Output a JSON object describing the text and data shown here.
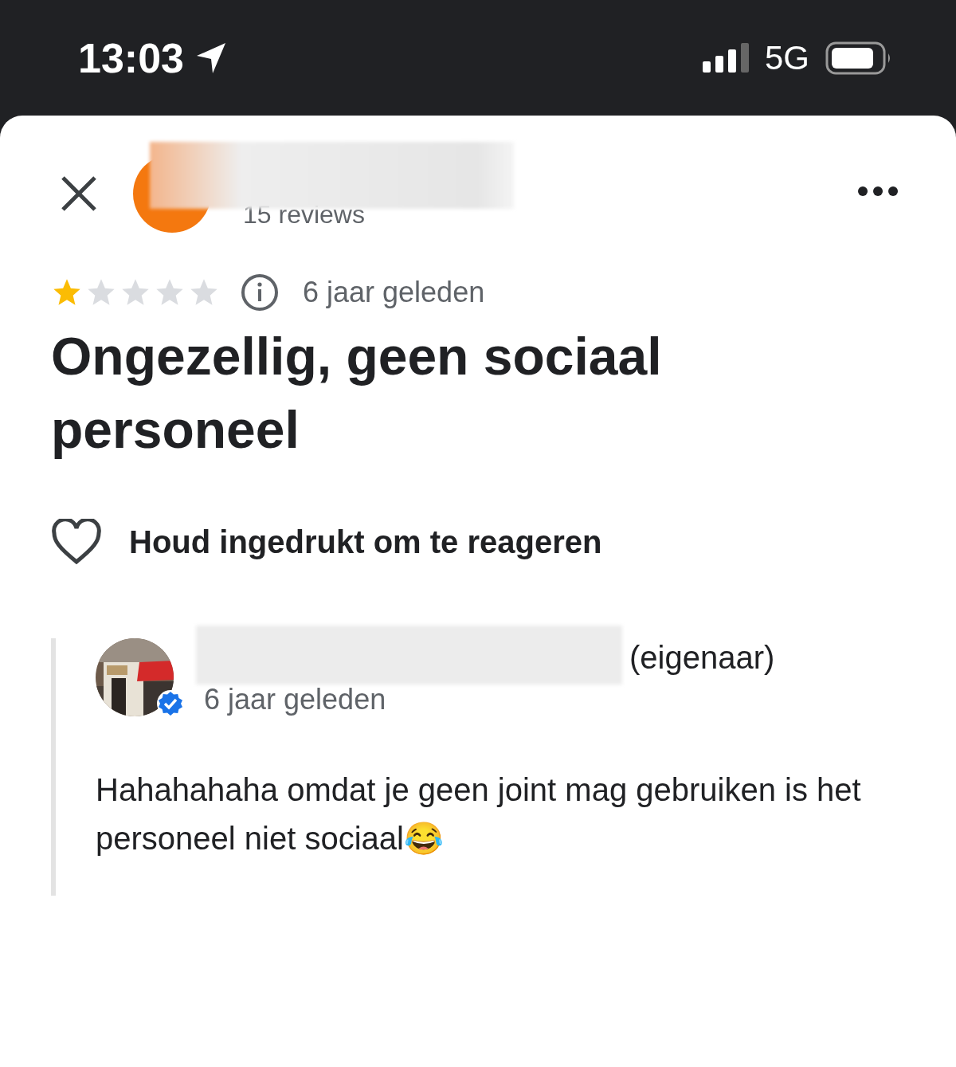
{
  "status_bar": {
    "time": "13:03",
    "network": "5G"
  },
  "reviewer": {
    "reviews": "15 reviews"
  },
  "review": {
    "stars": 1,
    "time": "6 jaar geleden",
    "title": "Ongezellig, geen sociaal personeel",
    "reaction_hint": "Houd ingedrukt om te reageren"
  },
  "owner_reply": {
    "role": "(eigenaar)",
    "time": "6 jaar geleden",
    "text": "Hahahahaha omdat je geen joint mag gebruiken is het personeel niet sociaal😂"
  }
}
